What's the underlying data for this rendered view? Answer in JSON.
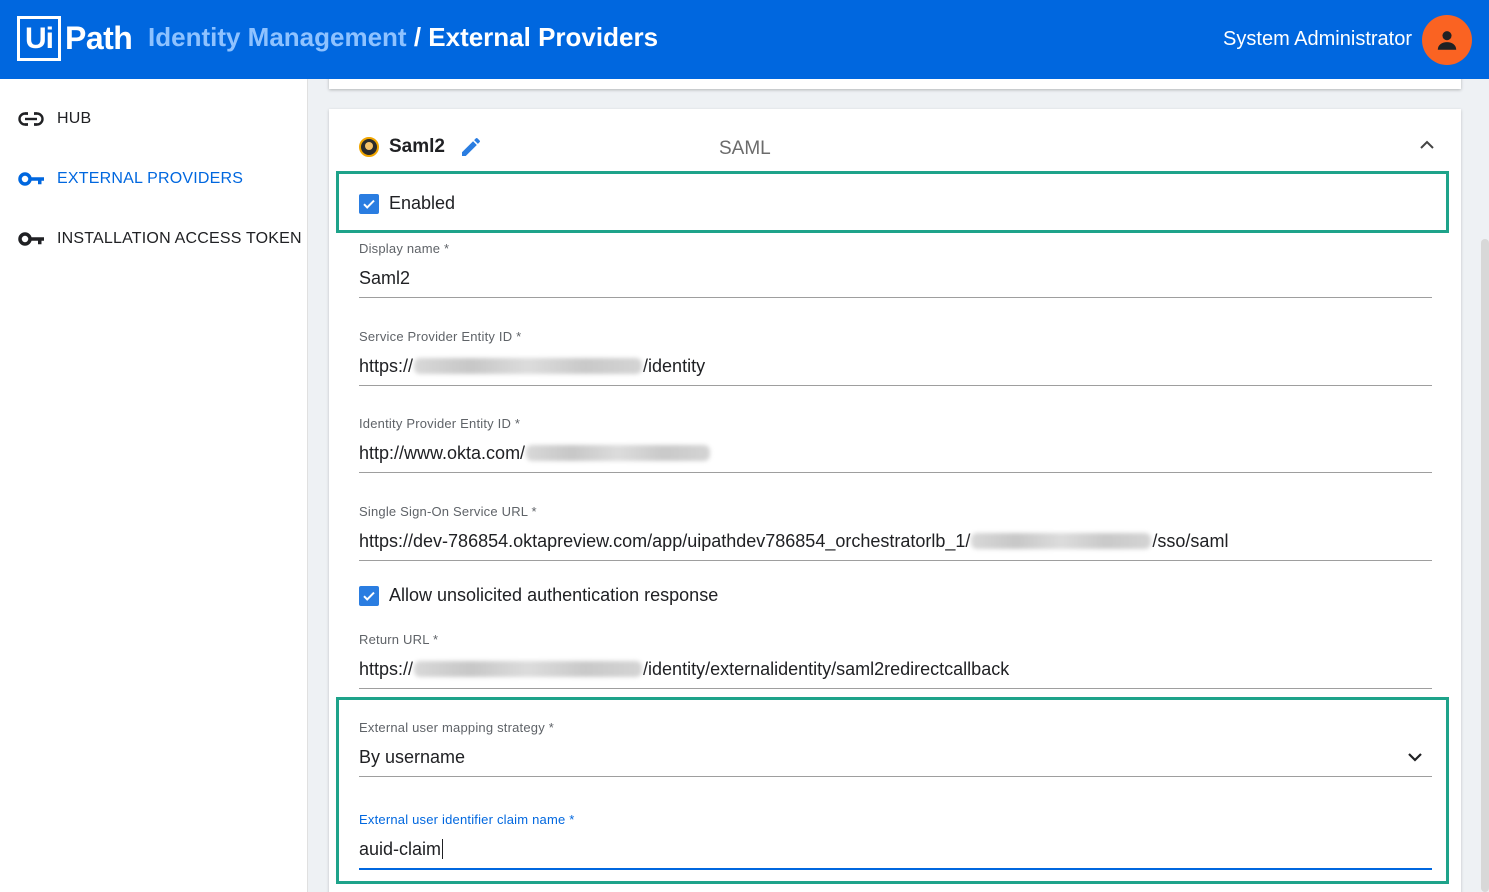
{
  "header": {
    "logo_box": "Ui",
    "logo_text": "Path",
    "title_part1": "Identity Management",
    "title_part2": " / External Providers",
    "user_name": "System Administrator",
    "brand_color": "#0067df",
    "avatar_color": "#fa6322"
  },
  "sidebar": {
    "items": [
      {
        "label": "HUB",
        "icon": "link-icon",
        "active": false
      },
      {
        "label": "EXTERNAL PROVIDERS",
        "icon": "key-icon",
        "active": true
      },
      {
        "label": "INSTALLATION ACCESS TOKEN",
        "icon": "key-icon",
        "active": false
      }
    ]
  },
  "provider": {
    "name": "Saml2",
    "type": "SAML",
    "enabled_label": "Enabled",
    "enabled": true,
    "fields": {
      "display_name": {
        "label": "Display name *",
        "value": "Saml2"
      },
      "sp_entity_id": {
        "label": "Service Provider Entity ID *",
        "prefix": "https://",
        "suffix": "/identity"
      },
      "idp_entity_id": {
        "label": "Identity Provider Entity ID *",
        "prefix": "http://www.okta.com/",
        "suffix": ""
      },
      "sso_url": {
        "label": "Single Sign-On Service URL *",
        "prefix": "https://dev-786854.oktapreview.com/app/uipathdev786854_orchestratorlb_1/",
        "suffix": "/sso/saml"
      },
      "return_url": {
        "label": "Return URL *",
        "prefix": "https://",
        "suffix": "/identity/externalidentity/saml2redirectcallback"
      },
      "mapping_strategy": {
        "label": "External user mapping strategy *",
        "value": "By username"
      },
      "claim_name": {
        "label": "External user identifier claim name *",
        "value": "auid-claim"
      }
    },
    "unsolicited_label": "Allow unsolicited authentication response",
    "unsolicited": true
  },
  "colors": {
    "highlight": "#1ea38a",
    "checkbox": "#2a7de1"
  }
}
